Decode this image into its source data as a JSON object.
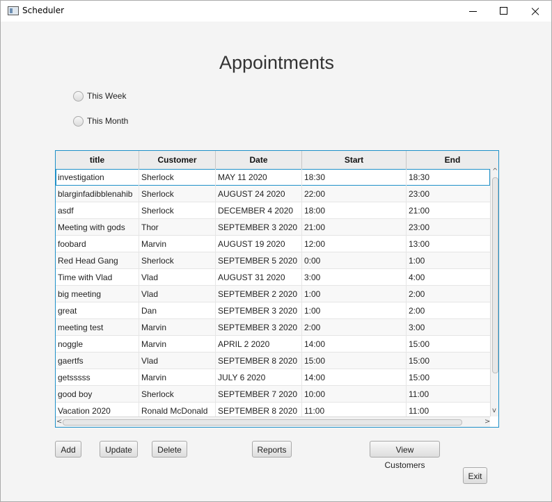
{
  "window": {
    "title": "Scheduler"
  },
  "heading": "Appointments",
  "filters": [
    {
      "label": "This Week"
    },
    {
      "label": "This Month"
    }
  ],
  "table": {
    "columns": [
      "title",
      "Customer",
      "Date",
      "Start",
      "End"
    ],
    "rows": [
      [
        "investigation",
        "Sherlock",
        "MAY 11 2020",
        "18:30",
        "18:30"
      ],
      [
        "blarginfadibblenahib",
        "Sherlock",
        "AUGUST 24 2020",
        "22:00",
        "23:00"
      ],
      [
        "asdf",
        "Sherlock",
        "DECEMBER 4 2020",
        "18:00",
        "21:00"
      ],
      [
        "Meeting with gods",
        "Thor",
        "SEPTEMBER 3 2020",
        "21:00",
        "23:00"
      ],
      [
        "foobard",
        "Marvin",
        "AUGUST 19 2020",
        "12:00",
        "13:00"
      ],
      [
        "Red Head Gang",
        "Sherlock",
        "SEPTEMBER 5 2020",
        "0:00",
        "1:00"
      ],
      [
        "Time with Vlad",
        "Vlad",
        "AUGUST 31 2020",
        "3:00",
        "4:00"
      ],
      [
        "big meeting",
        "Vlad",
        "SEPTEMBER 2 2020",
        "1:00",
        "2:00"
      ],
      [
        "great",
        "Dan",
        "SEPTEMBER 3 2020",
        "1:00",
        "2:00"
      ],
      [
        "meeting test",
        "Marvin",
        "SEPTEMBER 3 2020",
        "2:00",
        "3:00"
      ],
      [
        "noggle",
        "Marvin",
        "APRIL 2 2020",
        "14:00",
        "15:00"
      ],
      [
        "gaertfs",
        "Vlad",
        "SEPTEMBER 8 2020",
        "15:00",
        "15:00"
      ],
      [
        "getsssss",
        "Marvin",
        "JULY 6 2020",
        "14:00",
        "15:00"
      ],
      [
        "good boy",
        "Sherlock",
        "SEPTEMBER 7 2020",
        "10:00",
        "11:00"
      ],
      [
        "Vacation 2020",
        "Ronald McDonald",
        "SEPTEMBER 8 2020",
        "11:00",
        "11:00"
      ]
    ]
  },
  "buttons": {
    "add": "Add",
    "update": "Update",
    "delete": "Delete",
    "reports": "Reports",
    "view_customers": "View Customers",
    "exit": "Exit"
  },
  "colors": {
    "accent": "#1e90c8",
    "background": "#f4f4f4"
  }
}
